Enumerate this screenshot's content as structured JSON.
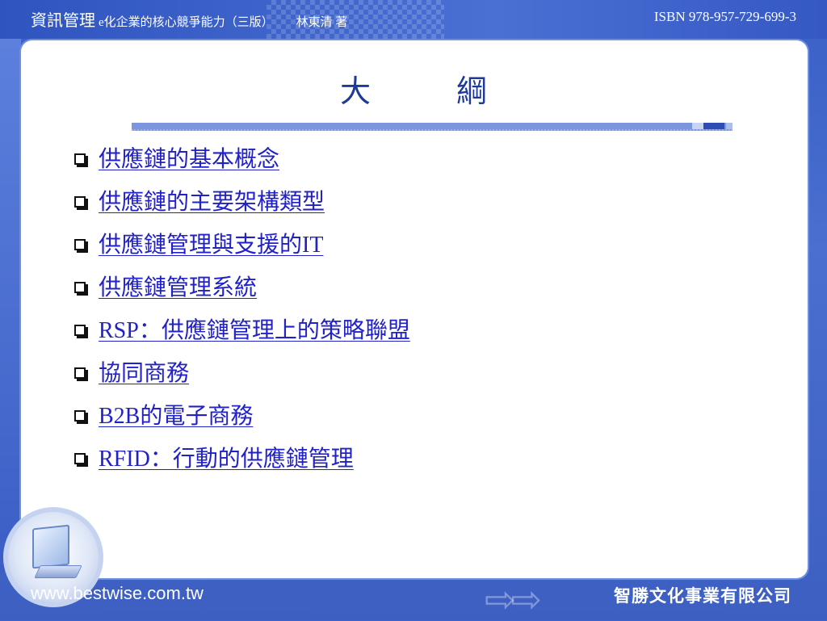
{
  "header": {
    "book_title": "資訊管理",
    "book_subtitle": "e化企業的核心競爭能力（三版）",
    "author": "林東清 著",
    "isbn": "ISBN 978-957-729-699-3"
  },
  "slide": {
    "title": "大　綱",
    "items": [
      {
        "label": "供應鏈的基本概念"
      },
      {
        "label": "供應鏈的主要架構類型"
      },
      {
        "label": "供應鏈管理與支援的IT"
      },
      {
        "label": "供應鏈管理系統"
      },
      {
        "label": "RSP：供應鏈管理上的策略聯盟"
      },
      {
        "label": "協同商務"
      },
      {
        "label": "B2B的電子商務"
      },
      {
        "label": "RFID：行動的供應鏈管理"
      }
    ]
  },
  "footer": {
    "url": "www.bestwise.com.tw",
    "company": "智勝文化事業有限公司"
  },
  "colors": {
    "background": "#3f63c8",
    "title": "#1d3a9a",
    "link": "#2121c8"
  },
  "icons": {
    "bullet": "hollow-square-bullet-icon",
    "logo": "computer-monitor-icon",
    "arrows": "double-arrow-icon"
  }
}
